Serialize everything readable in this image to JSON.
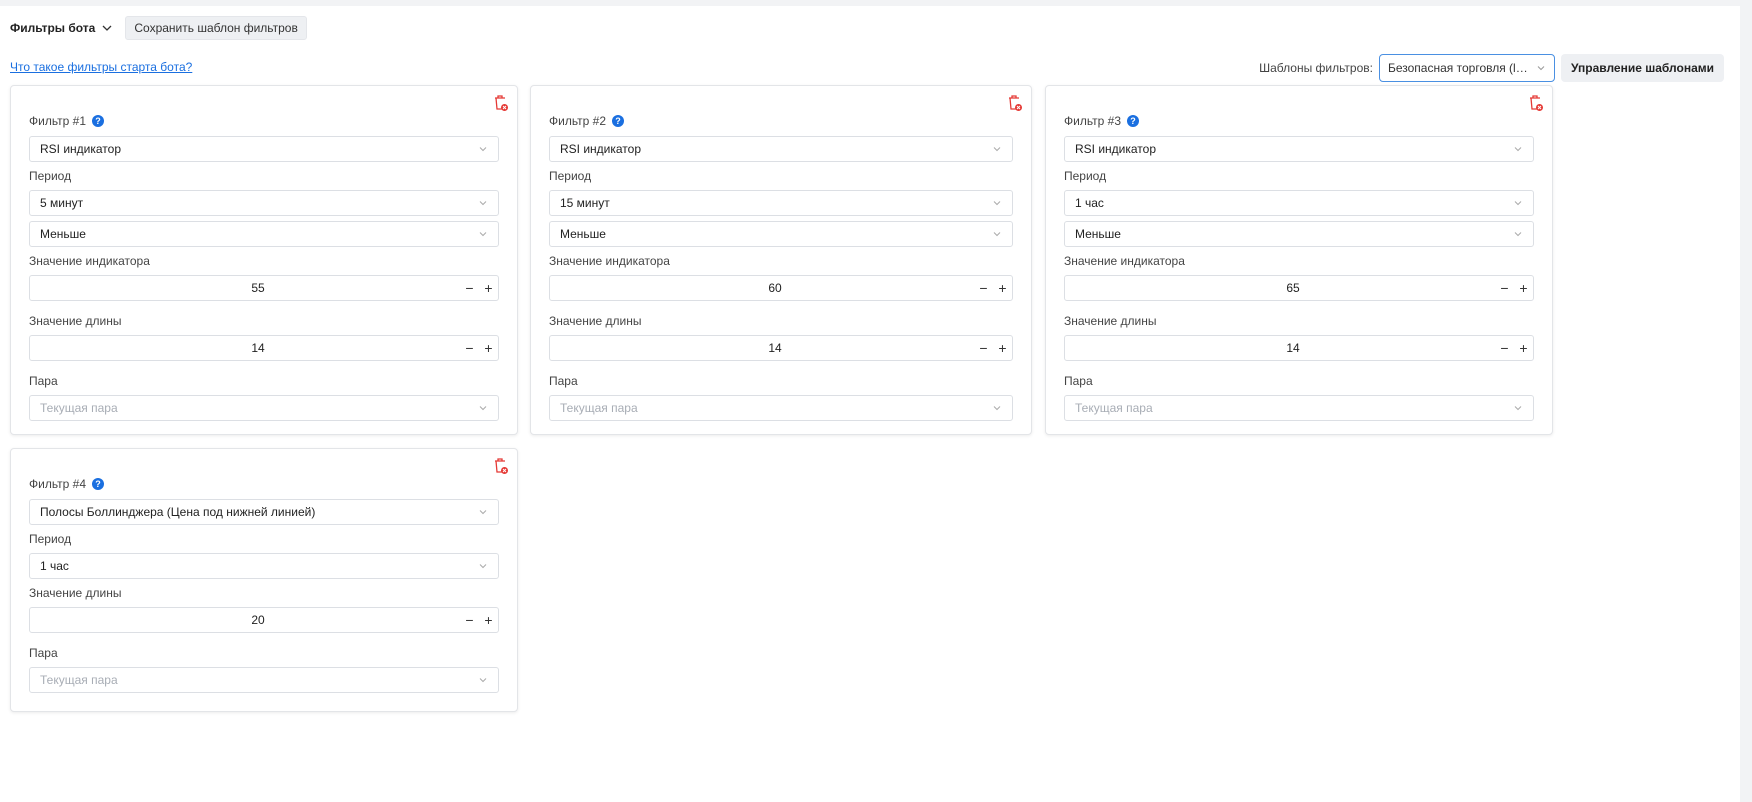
{
  "header": {
    "title": "Фильтры бота",
    "save_template": "Сохранить шаблон фильтров",
    "help_link": "Что такое фильтры старта бота?",
    "templates_label": "Шаблоны фильтров:",
    "templates_selected": "Безопасная торговля (lo...",
    "manage_templates": "Управление шаблонами"
  },
  "labels": {
    "period": "Период",
    "indicator_value": "Значение индикатора",
    "length_value": "Значение длины",
    "pair": "Пара",
    "pair_placeholder": "Текущая пара",
    "minus": "−",
    "plus": "+"
  },
  "filters": [
    {
      "title": "Фильтр #1",
      "type": "RSI индикатор",
      "period": "5 минут",
      "condition": "Меньше",
      "indicator_value": "55",
      "length_value": "14"
    },
    {
      "title": "Фильтр #2",
      "type": "RSI индикатор",
      "period": "15 минут",
      "condition": "Меньше",
      "indicator_value": "60",
      "length_value": "14"
    },
    {
      "title": "Фильтр #3",
      "type": "RSI индикатор",
      "period": "1 час",
      "condition": "Меньше",
      "indicator_value": "65",
      "length_value": "14"
    },
    {
      "title": "Фильтр #4",
      "type": "Полосы Боллинджера (Цена под нижней линией)",
      "period": "1 час",
      "length_value": "20"
    }
  ],
  "colors": {
    "accent": "#1a6fe0",
    "delete": "#e53935"
  }
}
